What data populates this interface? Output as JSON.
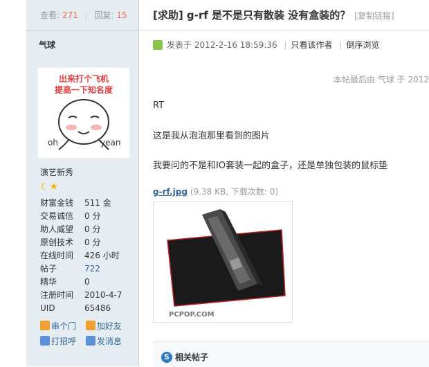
{
  "sidebar": {
    "views_label": "查看:",
    "views_value": "271",
    "replies_label": "回复:",
    "replies_value": "15",
    "author_name": "气球",
    "avatar_text_line1": "出来打个飞机",
    "avatar_text_line2": "提高一下知名度",
    "avatar_text_oh": "oh",
    "avatar_text_yean": "yean",
    "user_title": "演艺新秀",
    "stats": [
      {
        "label": "财富金钱",
        "value": "511 金"
      },
      {
        "label": "交易诚信",
        "value": "0 分"
      },
      {
        "label": "助人威望",
        "value": "0 分"
      },
      {
        "label": "原创技术",
        "value": "0 分"
      },
      {
        "label": "在线时间",
        "value": "426 小时"
      },
      {
        "label": "帖子",
        "value": "722"
      },
      {
        "label": "精华",
        "value": "0"
      },
      {
        "label": "注册时间",
        "value": "2010-4-7"
      },
      {
        "label": "UID",
        "value": "65486"
      }
    ],
    "actions": [
      {
        "label": "串个门",
        "icon": "home-icon",
        "color": "#f0a030"
      },
      {
        "label": "加好友",
        "icon": "add-friend-icon",
        "color": "#f0a030"
      },
      {
        "label": "打招呼",
        "icon": "greet-icon",
        "color": "#5b8fd6"
      },
      {
        "label": "发消息",
        "icon": "message-icon",
        "color": "#5b8fd6"
      }
    ]
  },
  "post": {
    "title": "[求助] g-rf 是不是只有散装 没有盒装的？",
    "copy_link": "[复制链接]",
    "posted_label": "发表于",
    "posted_time": "2012-2-16 18:59:36",
    "only_author": "只看该作者",
    "reverse_view": "倒序浏览",
    "last_edit": "本帖最后由 气球 于 2012",
    "paragraphs": [
      "RT",
      "这是我从泡泡那里看到的图片",
      "我要问的不是和IO套装一起的盒子，还是单独包装的鼠标垫"
    ],
    "attachment_name": "g-rf.jpg",
    "attachment_meta": "(9.38 KB, 下载次数: 0)",
    "attachment_watermark": "PCPOP.COM",
    "related_label": "相关帖子",
    "related_icon_glyph": "S"
  }
}
